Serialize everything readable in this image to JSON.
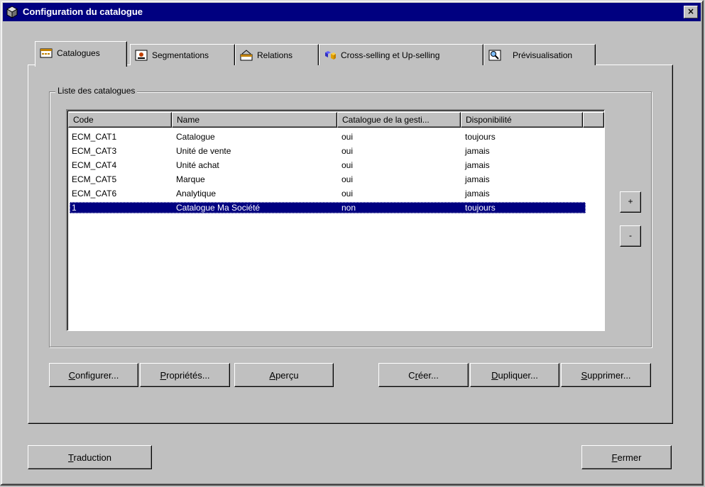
{
  "window": {
    "title": "Configuration du catalogue",
    "close_label": "×"
  },
  "tabs": [
    {
      "label": "Catalogues",
      "icon": "catalog-icon"
    },
    {
      "label": "Segmentations",
      "icon": "segment-icon"
    },
    {
      "label": "Relations",
      "icon": "relations-icon"
    },
    {
      "label": "Cross-selling et Up-selling",
      "icon": "cubes-icon"
    },
    {
      "label": "Prévisualisation",
      "icon": "magnifier-icon"
    }
  ],
  "group": {
    "label": "Liste des catalogues"
  },
  "list": {
    "columns": [
      "Code",
      "Name",
      "Catalogue de la gesti...",
      "Disponibilité"
    ],
    "rows": [
      [
        "ECM_CAT1",
        "Catalogue",
        "oui",
        "toujours"
      ],
      [
        "ECM_CAT3",
        "Unité de vente",
        "oui",
        "jamais"
      ],
      [
        "ECM_CAT4",
        "Unité achat",
        "oui",
        "jamais"
      ],
      [
        "ECM_CAT5",
        "Marque",
        "oui",
        "jamais"
      ],
      [
        "ECM_CAT6",
        "Analytique",
        "oui",
        "jamais"
      ],
      [
        "1",
        "Catalogue Ma Société",
        "non",
        "toujours"
      ]
    ],
    "selected_row": 5
  },
  "side_buttons": {
    "add": "+",
    "remove": "-"
  },
  "actions": {
    "configurer": {
      "mnemonic": "C",
      "rest": "onfigurer..."
    },
    "proprietes": {
      "mnemonic": "P",
      "rest": "ropriétés..."
    },
    "apercu": {
      "mnemonic": "A",
      "rest": "perçu"
    },
    "creer": {
      "pre": "C",
      "mnemonic": "r",
      "rest": "éer..."
    },
    "dupliquer": {
      "mnemonic": "D",
      "rest": "upliquer..."
    },
    "supprimer": {
      "mnemonic": "S",
      "rest": "upprimer..."
    }
  },
  "footer": {
    "traduction": {
      "mnemonic": "T",
      "rest": "raduction"
    },
    "fermer": {
      "mnemonic": "F",
      "rest": "ermer"
    }
  }
}
